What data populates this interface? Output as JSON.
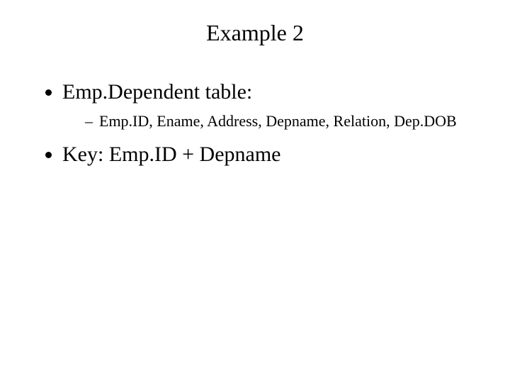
{
  "title": "Example 2",
  "bullets": {
    "b1": {
      "text": "Emp.Dependent table:",
      "sub1": "Emp.ID, Ename, Address, Depname, Relation, Dep.DOB"
    },
    "b2": {
      "text": "Key: Emp.ID + Depname"
    }
  }
}
